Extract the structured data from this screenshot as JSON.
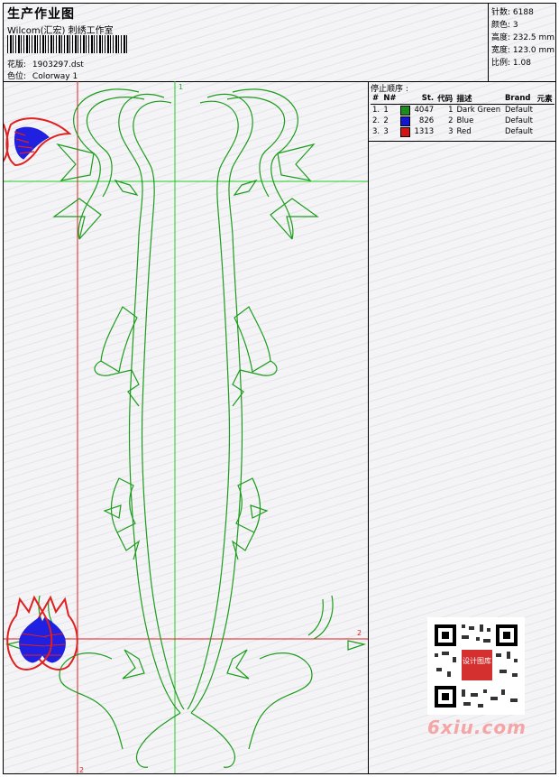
{
  "header": {
    "title": "生产作业图",
    "subtitle": "Wilcom(汇宏) 刺绣工作室",
    "design_label": "花版:",
    "design_value": "1903297.dst",
    "colorway_label": "色位:",
    "colorway_value": "Colorway 1"
  },
  "stats": {
    "stitches": "针数: 6188",
    "colors": "颜色: 3",
    "height": "高度: 232.5 mm",
    "width": "宽度: 123.0 mm",
    "ratio": "比例: 1.08"
  },
  "stop_sequence": {
    "title": "停止顺序 :",
    "headers": [
      "#",
      "N#",
      "St.",
      "代码",
      "描述",
      "Brand",
      "元素"
    ],
    "rows": [
      {
        "index": "1.",
        "n": "1",
        "color": "#1c8c1c",
        "stitches": "4047",
        "code": "1",
        "desc": "Dark Green",
        "brand": "Default"
      },
      {
        "index": "2.",
        "n": "2",
        "color": "#1414d2",
        "stitches": "826",
        "code": "2",
        "desc": "Blue",
        "brand": "Default"
      },
      {
        "index": "3.",
        "n": "3",
        "color": "#d21414",
        "stitches": "1313",
        "code": "3",
        "desc": "Red",
        "brand": "Default"
      }
    ]
  },
  "guides": {
    "vertical_top": "1",
    "horizontal_right": "2",
    "vertical_bottom": "2"
  },
  "colors": {
    "green": "#1c9c1c",
    "blue": "#2020e0",
    "red": "#e02020",
    "guide_green": "#22cc22",
    "guide_red": "#dd2222"
  },
  "watermark": {
    "qr_badge": "设计图库",
    "site": "6xiu.com"
  }
}
